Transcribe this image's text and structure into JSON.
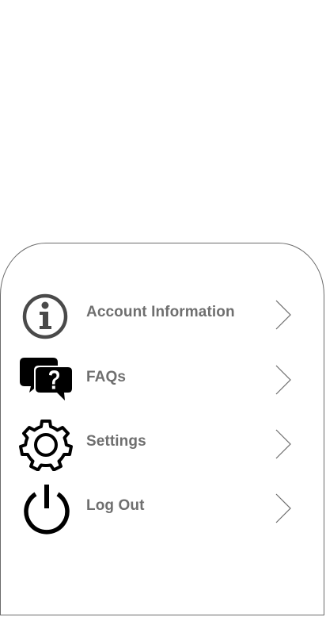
{
  "menu": {
    "items": [
      {
        "label": "Account Information",
        "icon": "info-icon"
      },
      {
        "label": "FAQs",
        "icon": "faq-chat-icon"
      },
      {
        "label": "Settings",
        "icon": "gear-icon"
      },
      {
        "label": "Log Out",
        "icon": "power-icon"
      }
    ]
  },
  "colors": {
    "label": "#6f6f6f",
    "icon": "#000000",
    "chevron": "#6b6b6b",
    "border": "#6b6b6b"
  }
}
